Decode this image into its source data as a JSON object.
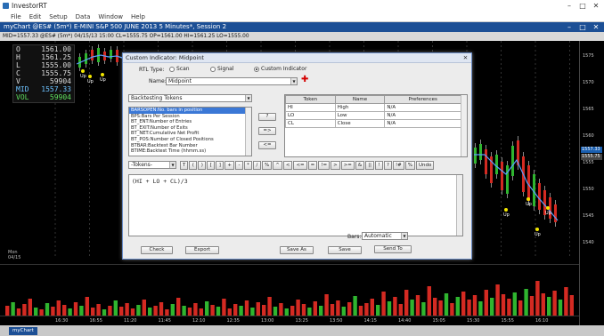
{
  "app": {
    "title": "InvestorRT"
  },
  "menu": [
    "File",
    "Edit",
    "Setup",
    "Data",
    "Window",
    "Help"
  ],
  "chart_window": {
    "title": "myChart @ES# (5m*) E-MINI S&P 500 JUNE 2013 5 Minutes*, Session 2",
    "info": "MID=1557.33  @ES# (5m*) 04/15/13 15:00 CL=1555.75 OP=1561.00 HI=1561.25 LO=1555.00"
  },
  "quote": [
    {
      "k": "O",
      "v": "1561.00"
    },
    {
      "k": "H",
      "v": "1561.25"
    },
    {
      "k": "L",
      "v": "1555.00"
    },
    {
      "k": "C",
      "v": "1555.75"
    },
    {
      "k": "V",
      "v": "59904"
    },
    {
      "k": "MID",
      "v": "1557.33"
    },
    {
      "k": "VOL",
      "v": "59904"
    }
  ],
  "price_axis": [
    "1575",
    "1570",
    "1565",
    "1560",
    "1555",
    "1550",
    "1545",
    "1540"
  ],
  "price_labels": {
    "close": "1555.75",
    "mid": "1557.33"
  },
  "date_label": {
    "line1": "Mon",
    "line2": "04/15"
  },
  "time_axis": [
    "16:30",
    "16:55",
    "11:20",
    "11:45",
    "12:10",
    "12:35",
    "13:00",
    "13:25",
    "13:50",
    "14:15",
    "14:40",
    "15:05",
    "15:30",
    "15:55",
    "16:10"
  ],
  "up_label": "Up",
  "bottom_tab": "myChart",
  "dialog": {
    "title": "Custom Indicator: Midpoint",
    "rtl_type_label": "RTL Type:",
    "radio_scan": "Scan",
    "radio_signal": "Signal",
    "radio_custom": "Custom Indicator",
    "name_label": "Name:",
    "name_value": "Midpoint",
    "backtesting_tokens": "Backtesting Tokens",
    "token_list": [
      "BARSOPEN:No. bars in position",
      "BPS:Bars Per Session",
      "BT_ENT:Number of Entries",
      "BT_EXIT:Number of Exits",
      "BT_NET:Cumulative Net Profit",
      "BT_POS:Number of Closed Positions",
      "BTBAR:Backtest Bar Number",
      "BTIME:Backtest Time (hhmm.ss)"
    ],
    "btn_help": "?",
    "btn_add": "=>",
    "btn_remove": "<=",
    "table": {
      "headers": [
        "Token",
        "Name",
        "Preferences"
      ],
      "rows": [
        [
          "HI",
          "High",
          "N/A"
        ],
        [
          "LO",
          "Low",
          "N/A"
        ],
        [
          "CL",
          "Close",
          "N/A"
        ]
      ]
    },
    "tokens_select": "-Tokens-",
    "operators": [
      "T",
      "(",
      ")",
      "[",
      "]",
      "+",
      "-",
      "*",
      "/",
      "%",
      "^",
      "<",
      "<=",
      "=",
      "!=",
      ">",
      ">=",
      "&",
      "||",
      "!",
      "?",
      "!#",
      "%",
      "Undo"
    ],
    "formula": "(HI + LO + CL)/3",
    "bars_label": "Bars:",
    "bars_value": "Automatic",
    "btn_check": "Check",
    "btn_export": "Export",
    "btn_saveas": "Save As",
    "btn_save": "Save",
    "btn_sendto": "Send To"
  },
  "colors": {
    "up": "#2fb52f",
    "down": "#d42a22",
    "mid_line": "#5aa0ff",
    "dialog_border": "#6a8cc7",
    "selection": "#3b78d6"
  }
}
